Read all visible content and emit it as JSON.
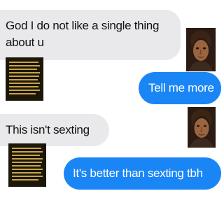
{
  "messages": [
    {
      "sender": "other",
      "text": "God I do not like a single thing about u"
    },
    {
      "sender": "me",
      "text": "Tell me more"
    },
    {
      "sender": "other",
      "text": "This isn't sexting"
    },
    {
      "sender": "me",
      "text": "It's better than sexting tbh"
    }
  ],
  "colors": {
    "incoming_bubble": "#e9e9eb",
    "outgoing_bubble": "#1a86f5"
  },
  "icons": [
    "avatar-portrait-icon",
    "text-sticker-icon"
  ]
}
